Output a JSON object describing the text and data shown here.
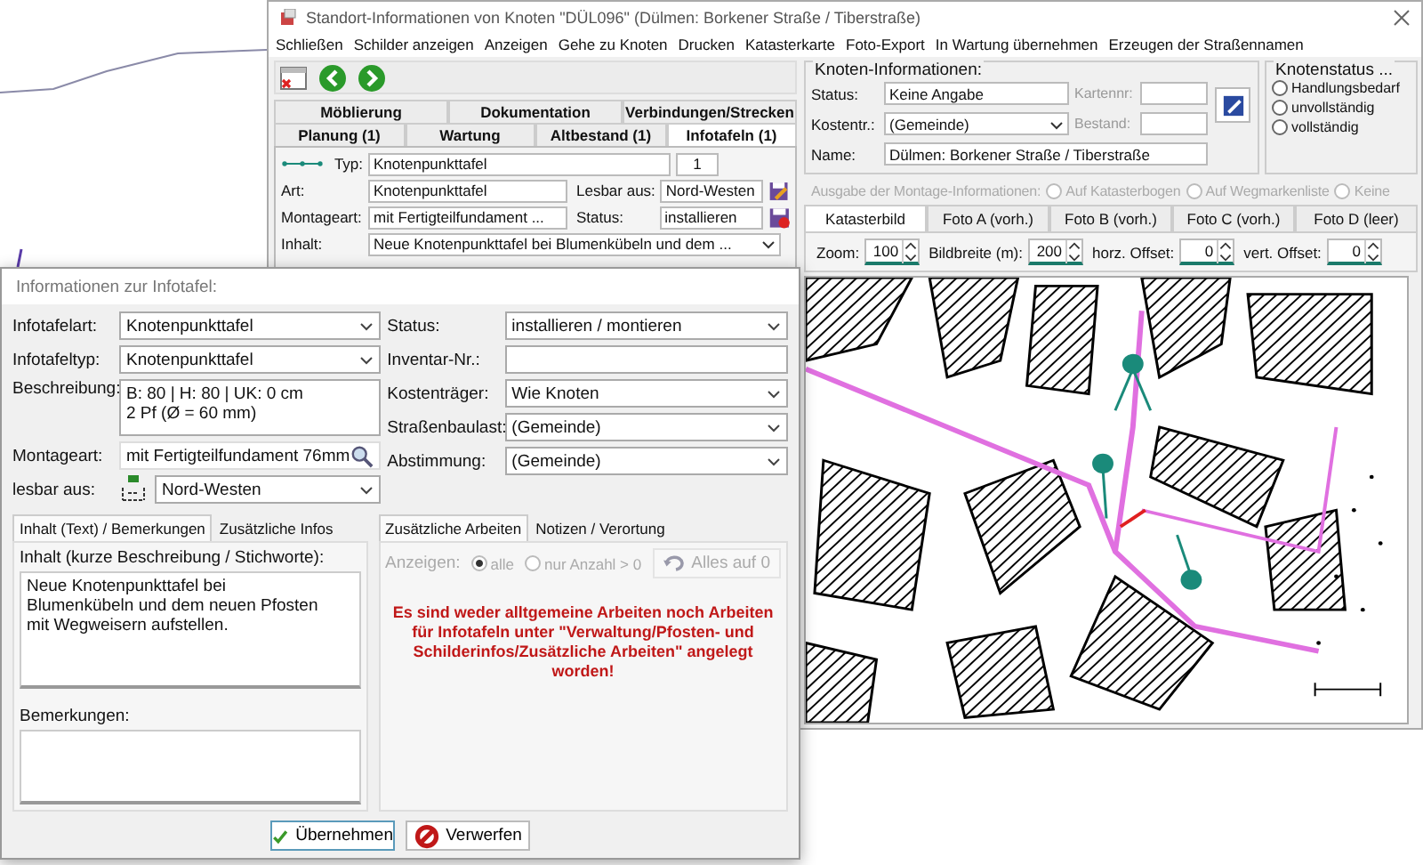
{
  "window": {
    "title": "Standort-Informationen von Knoten \"DÜL096\" (Dülmen: Borkener Straße / Tiberstraße)",
    "menu": [
      "Schließen",
      "Schilder anzeigen",
      "Anzeigen",
      "Gehe zu Knoten",
      "Drucken",
      "Katasterkarte",
      "Foto-Export",
      "In Wartung übernehmen",
      "Erzeugen der Straßennamen"
    ]
  },
  "tab_rows": [
    {
      "tabs": [
        {
          "label": "Möblierung",
          "selected": false
        },
        {
          "label": "Dokumentation",
          "selected": false
        },
        {
          "label": "Verbindungen/Strecken",
          "selected": false
        }
      ]
    },
    {
      "tabs": [
        {
          "label": "Planung (1)",
          "selected": false
        },
        {
          "label": "Wartung",
          "selected": false
        },
        {
          "label": "Altbestand (1)",
          "selected": false
        },
        {
          "label": "Infotafeln (1)",
          "selected": true
        }
      ]
    }
  ],
  "infotafel": {
    "typ_label": "Typ:",
    "typ": "Knotenpunkttafel",
    "count": "1",
    "art_label": "Art:",
    "art": "Knotenpunkttafel",
    "lesbar_label": "Lesbar aus:",
    "lesbar": "Nord-Westen",
    "montage_label": "Montageart:",
    "montage": "mit Fertigteilfundament ...",
    "status_label": "Status:",
    "status": "installieren",
    "inhalt_label": "Inhalt:",
    "inhalt": "Neue Knotenpunkttafel bei Blumenkübeln und dem ..."
  },
  "knoten_info": {
    "title": "Knoten-Informationen:",
    "status_label": "Status:",
    "status": "Keine Angabe",
    "kartennr_label": "Kartennr:",
    "kostentr_label": "Kostentr.:",
    "kostentr": "(Gemeinde)",
    "bestand_label": "Bestand:",
    "name_label": "Name:",
    "name": "Dülmen: Borkener Straße / Tiberstraße"
  },
  "knotenstatus": {
    "title": "Knotenstatus ...",
    "options": [
      {
        "label": "Handlungsbedarf",
        "selected": false
      },
      {
        "label": "unvollständig",
        "selected": false
      },
      {
        "label": "vollständig",
        "selected": false
      }
    ]
  },
  "ausgabe": {
    "label": "Ausgabe der Montage-Informationen:",
    "disabled": true,
    "options": [
      {
        "label": "Auf Katasterbogen",
        "selected": false
      },
      {
        "label": "Auf Wegmarkenliste",
        "selected": false
      },
      {
        "label": "Keine",
        "selected": false
      }
    ]
  },
  "photo_tabs": [
    {
      "label": "Katasterbild",
      "selected": true
    },
    {
      "label": "Foto A (vorh.)",
      "selected": false
    },
    {
      "label": "Foto B (vorh.)",
      "selected": false
    },
    {
      "label": "Foto C (vorh.)",
      "selected": false
    },
    {
      "label": "Foto D (leer)",
      "selected": false
    }
  ],
  "map_controls": [
    {
      "label": "Zoom:",
      "value": "100"
    },
    {
      "label": "Bildbreite (m):",
      "value": "200"
    },
    {
      "label": "horz. Offset:",
      "value": "0"
    },
    {
      "label": "vert. Offset:",
      "value": "0"
    }
  ],
  "dialog": {
    "title": "Informationen zur Infotafel:",
    "left_fields": [
      {
        "label": "Infotafelart:",
        "kind": "select",
        "value": "Knotenpunkttafel"
      },
      {
        "label": "Infotafeltyp:",
        "kind": "select",
        "value": "Knotenpunkttafel"
      },
      {
        "label": "Beschreibung:",
        "kind": "textarea",
        "value": "B: 80 | H: 80 | UK: 0 cm\n2 Pf (Ø = 60 mm)"
      },
      {
        "label": "Montageart:",
        "kind": "search",
        "value": "mit Fertigteilfundament 76mm"
      },
      {
        "label": "lesbar aus:",
        "kind": "direction",
        "value": "Nord-Westen"
      }
    ],
    "right_fields": [
      {
        "label": "Status:",
        "kind": "select",
        "value": "installieren / montieren"
      },
      {
        "label": "Inventar-Nr.:",
        "kind": "input"
      },
      {
        "label": "Kostenträger:",
        "kind": "select",
        "value": "Wie Knoten"
      },
      {
        "label": "Straßenbaulast:",
        "kind": "select",
        "value": "(Gemeinde)"
      },
      {
        "label": "Abstimmung:",
        "kind": "select",
        "value": "(Gemeinde)"
      }
    ],
    "left_tabs": [
      {
        "label": "Inhalt (Text) / Bemerkungen",
        "selected": true
      },
      {
        "label": "Zusätzliche Infos",
        "selected": false
      }
    ],
    "inhalt_label": "Inhalt (kurze Beschreibung / Stichworte):",
    "inhalt": "Neue Knotenpunkttafel bei Blumenkübeln und dem neuen Pfosten mit Wegweisern aufstellen.",
    "bemerkungen_label": "Bemerkungen:",
    "right_tabs": [
      {
        "label": "Zusätzliche Arbeiten",
        "selected": true
      },
      {
        "label": "Notizen / Verortung",
        "selected": false
      }
    ],
    "anzeigen": {
      "label": "Anzeigen:",
      "disabled": true,
      "options": [
        {
          "label": "alle",
          "selected": true
        },
        {
          "label": "nur Anzahl > 0",
          "selected": false
        }
      ]
    },
    "reset_button": {
      "label": "Alles auf 0",
      "disabled": true
    },
    "message": "Es sind weder alltgemeine Arbeiten noch Arbeiten für Infotafeln unter \"Verwaltung/Pfosten- und Schilderinfos/Zusätzliche Arbeiten\" angelegt worden!",
    "buttons": [
      {
        "label": "Übernehmen",
        "kind": "confirm"
      },
      {
        "label": "Verwerfen",
        "kind": "discard"
      }
    ]
  }
}
